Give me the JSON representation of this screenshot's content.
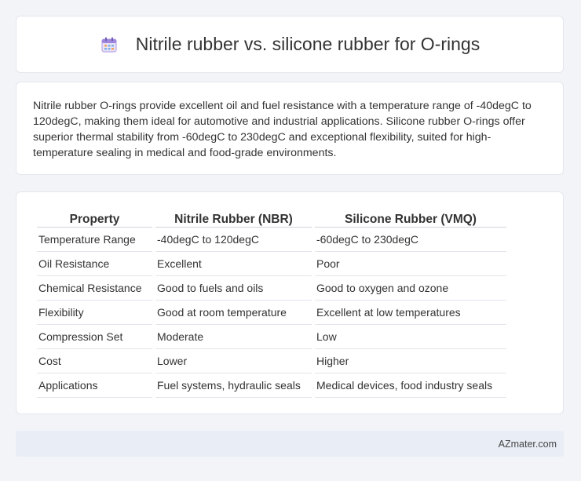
{
  "header": {
    "icon": "calendar-icon",
    "title": "Nitrile rubber vs. silicone rubber for O-rings"
  },
  "summary": {
    "text": "Nitrile rubber O-rings provide excellent oil and fuel resistance with a temperature range of -40degC to 120degC, making them ideal for automotive and industrial applications. Silicone rubber O-rings offer superior thermal stability from -60degC to 230degC and exceptional flexibility, suited for high-temperature sealing in medical and food-grade environments."
  },
  "table": {
    "headers": [
      "Property",
      "Nitrile Rubber (NBR)",
      "Silicone Rubber (VMQ)"
    ],
    "rows": [
      [
        "Temperature Range",
        "-40degC to 120degC",
        "-60degC to 230degC"
      ],
      [
        "Oil Resistance",
        "Excellent",
        "Poor"
      ],
      [
        "Chemical Resistance",
        "Good to fuels and oils",
        "Good to oxygen and ozone"
      ],
      [
        "Flexibility",
        "Good at room temperature",
        "Excellent at low temperatures"
      ],
      [
        "Compression Set",
        "Moderate",
        "Low"
      ],
      [
        "Cost",
        "Lower",
        "Higher"
      ],
      [
        "Applications",
        "Fuel systems, hydraulic seals",
        "Medical devices, food industry seals"
      ]
    ]
  },
  "footer": {
    "text": "AZmater.com"
  }
}
